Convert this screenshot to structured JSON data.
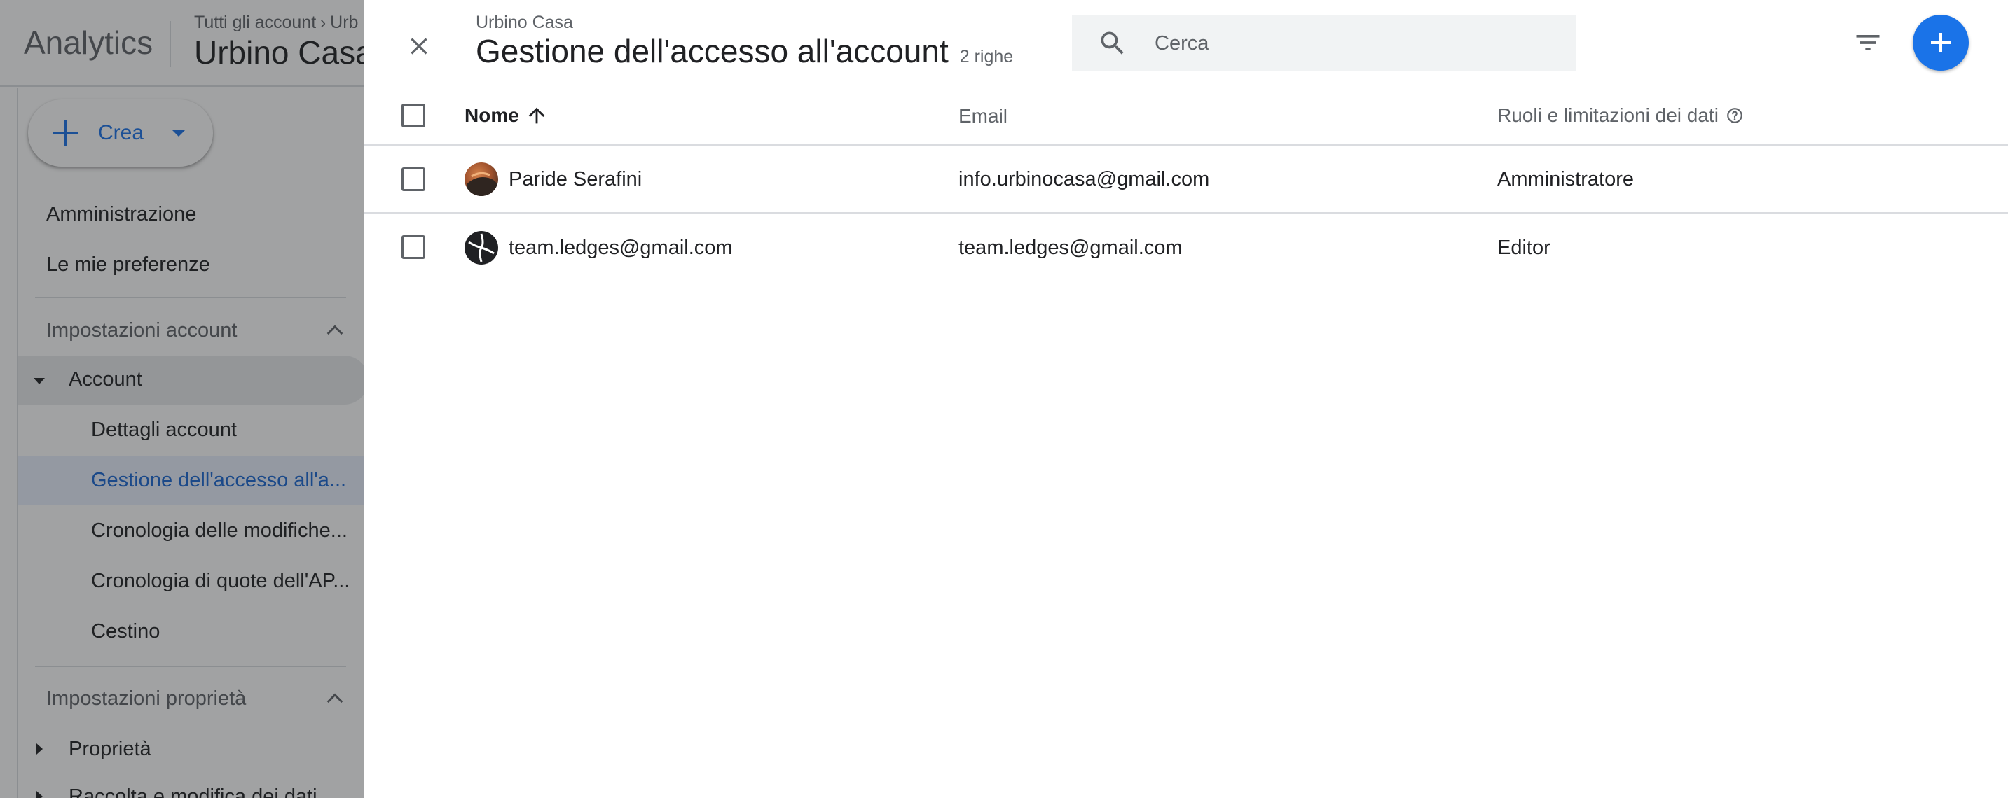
{
  "background_app": {
    "product_name": "Analytics",
    "breadcrumb": [
      "Tutti gli account",
      "Urb"
    ],
    "account_title": "Urbino Casa",
    "create_label": "Crea",
    "nav": {
      "admin": "Amministrazione",
      "preferences": "Le mie preferenze",
      "account_settings": "Impostazioni account",
      "account": "Account",
      "account_children": [
        "Dettagli account",
        "Gestione dell'accesso all'a...",
        "Cronologia delle modifiche...",
        "Cronologia di quote dell'AP...",
        "Cestino"
      ],
      "property_settings": "Impostazioni proprietà",
      "property": "Proprietà",
      "data_collection": "Raccolta e modifica dei dati"
    }
  },
  "drawer": {
    "breadcrumb": "Urbino Casa",
    "title": "Gestione dell'accesso all'account",
    "row_count": "2 righe",
    "search": {
      "placeholder": "Cerca",
      "value": ""
    },
    "table": {
      "columns": {
        "name": "Nome",
        "email": "Email",
        "roles": "Ruoli e limitazioni dei dati"
      },
      "sort": {
        "column": "name",
        "direction": "ascending"
      },
      "rows": [
        {
          "name": "Paride Serafini",
          "email": "info.urbinocasa@gmail.com",
          "role": "Amministratore",
          "avatar": "photo-avatar"
        },
        {
          "name": "team.ledges@gmail.com",
          "email": "team.ledges@gmail.com",
          "role": "Editor",
          "avatar": "logo-avatar"
        }
      ]
    },
    "icons": {
      "close": "close-icon",
      "search": "search-icon",
      "filter": "filter-icon",
      "add": "plus-icon",
      "help": "help-icon",
      "sort": "arrow-up-icon"
    }
  },
  "colors": {
    "accent": "#1a73e8",
    "text_primary": "#202124",
    "text_secondary": "#5f6368",
    "divider": "#dadce0",
    "search_bg": "#f1f3f4"
  }
}
